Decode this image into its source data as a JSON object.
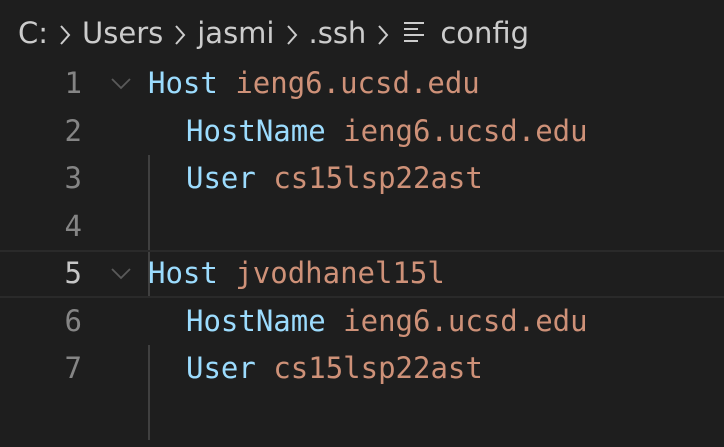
{
  "breadcrumb": {
    "items": [
      "C:",
      "Users",
      "jasmi",
      ".ssh"
    ],
    "file": "config",
    "file_icon": "text-lines-icon",
    "separator_icon": "chevron-right-icon"
  },
  "colors": {
    "background": "#1e1e1e",
    "keyword": "#9cdcfe",
    "value": "#ce9178",
    "line_number": "#858585",
    "line_number_active": "#c6c6c6"
  },
  "editor": {
    "lines": [
      {
        "number": "1",
        "key": "Host",
        "value": "ieng6.ucsd.edu"
      },
      {
        "number": "2",
        "key": "HostName",
        "value": "ieng6.ucsd.edu"
      },
      {
        "number": "3",
        "key": "User",
        "value": "cs15lsp22ast"
      },
      {
        "number": "4",
        "key": "",
        "value": ""
      },
      {
        "number": "5",
        "key": "Host",
        "value": "jvodhanel15l"
      },
      {
        "number": "6",
        "key": "HostName",
        "value": "ieng6.ucsd.edu"
      },
      {
        "number": "7",
        "key": "User",
        "value": "cs15lsp22ast"
      }
    ],
    "active_line": "5"
  }
}
